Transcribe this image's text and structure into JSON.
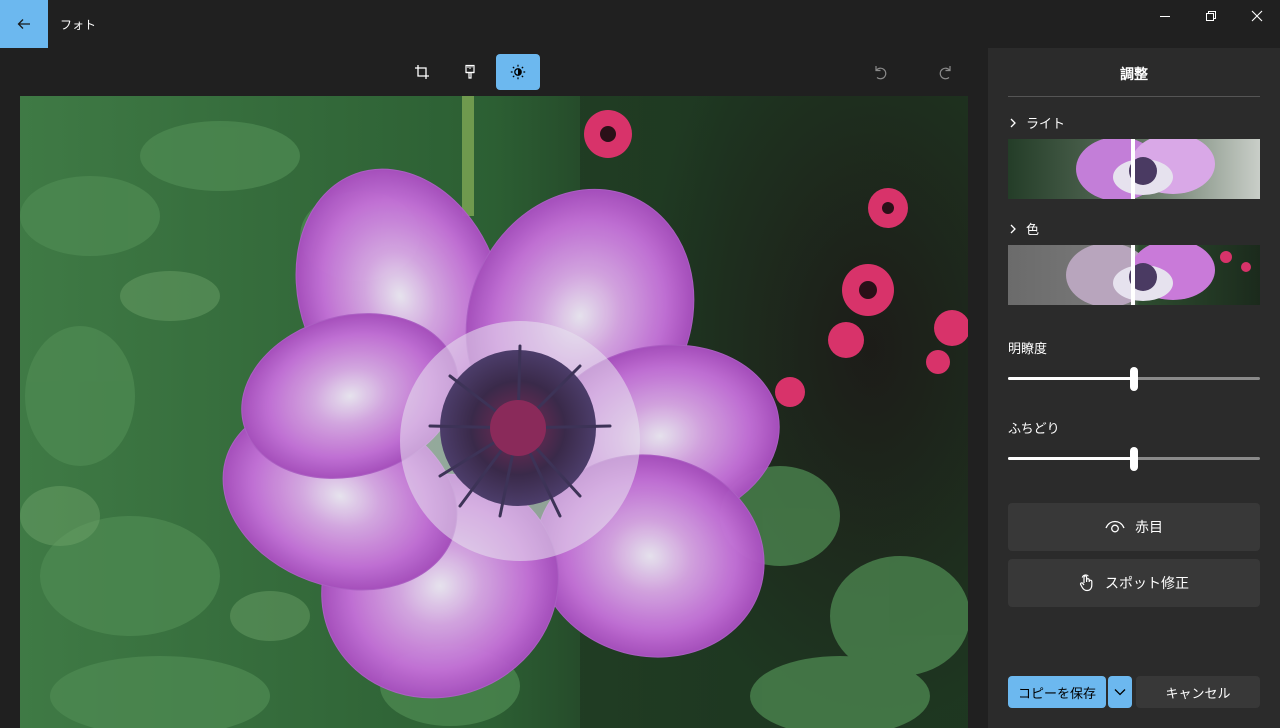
{
  "app": {
    "title": "フォト"
  },
  "toolbar": {
    "tools": [
      {
        "icon": "crop-icon"
      },
      {
        "icon": "filter-brush-icon"
      },
      {
        "icon": "brightness-icon",
        "active": true
      }
    ],
    "undo_icon": "undo-icon",
    "redo_icon": "redo-icon"
  },
  "panel": {
    "title": "調整",
    "sections": [
      {
        "label": "ライト",
        "icon": "chevron-right-icon"
      },
      {
        "label": "色",
        "icon": "chevron-right-icon"
      }
    ],
    "sliders": [
      {
        "label": "明瞭度",
        "value": 0.5
      },
      {
        "label": "ふちどり",
        "value": 0.5
      }
    ],
    "buttons": {
      "red_eye": "赤目",
      "spot_fix": "スポット修正",
      "save_copy": "コピーを保存",
      "cancel": "キャンセル"
    }
  },
  "colors": {
    "accent": "#6cb8ef",
    "background": "#202020",
    "panel": "#2b2b2b",
    "button": "#383838"
  }
}
